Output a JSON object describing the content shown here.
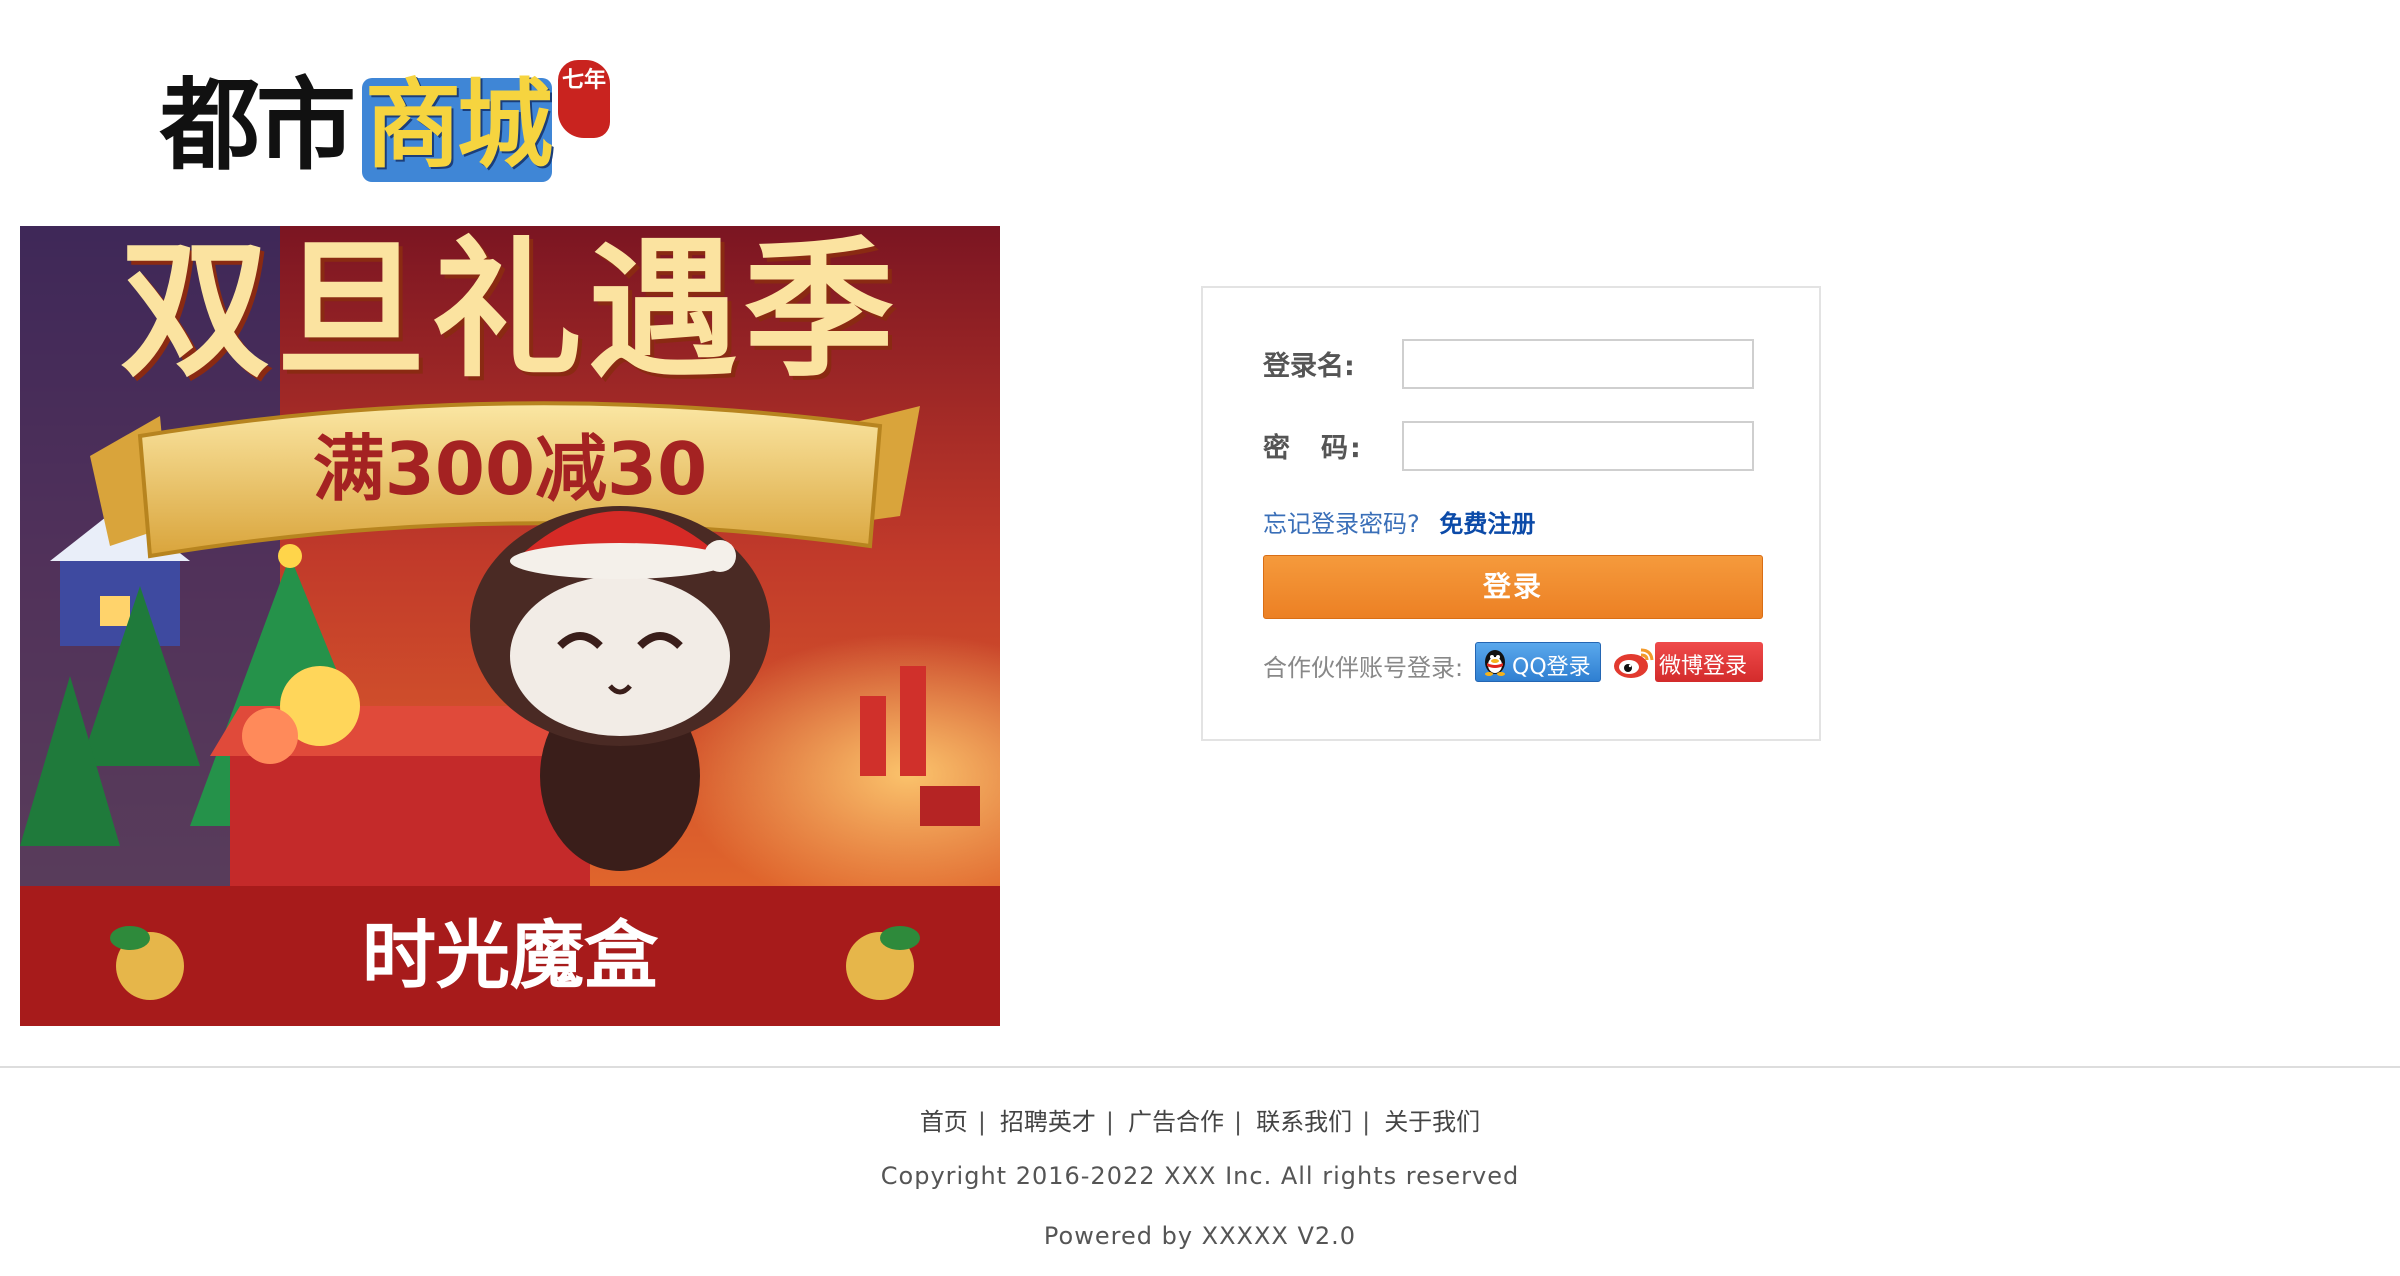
{
  "logo": {
    "part1": "都市",
    "part2": "商城",
    "seal": "七年"
  },
  "banner": {
    "headline": "双旦礼遇季",
    "promo": "满300减30",
    "footer_text": "时光魔盒"
  },
  "login": {
    "username_label": "登录名:",
    "password_label": "密　码:",
    "username_value": "",
    "password_value": "",
    "forgot_link": "忘记登录密码?",
    "register_link": "免费注册",
    "submit_label": "登录",
    "partner_label": "合作伙伴账号登录:",
    "qq_label": "QQ登录",
    "weibo_label": "微博登录"
  },
  "footer": {
    "nav": [
      "首页",
      "招聘英才",
      "广告合作",
      "联系我们",
      "关于我们"
    ],
    "separator": "|",
    "copyright": "Copyright 2016-2022 XXX Inc. All rights reserved",
    "powered": "Powered by XXXXX V2.0"
  },
  "colors": {
    "login_button": "#ec8024",
    "link_blue": "#3a6fb8",
    "qq_blue": "#2f7fd1",
    "weibo_red": "#d32b2b",
    "banner_red": "#a71b1b"
  }
}
